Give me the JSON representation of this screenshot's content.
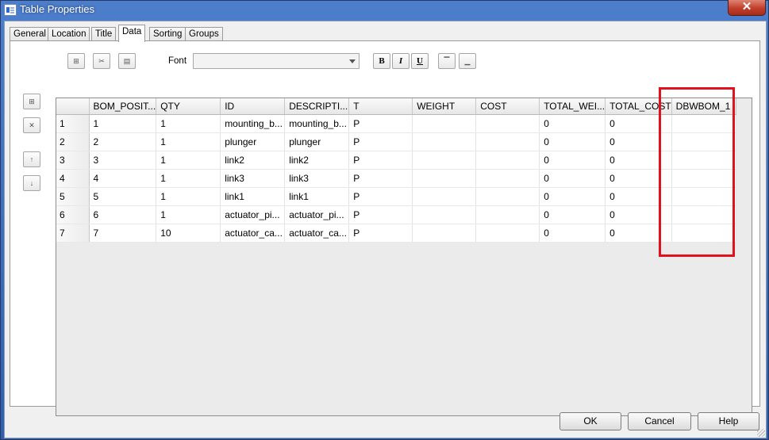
{
  "window": {
    "title": "Table Properties",
    "close_label": "✕"
  },
  "tabs": [
    {
      "label": "General"
    },
    {
      "label": "Location"
    },
    {
      "label": "Title"
    },
    {
      "label": "Data"
    },
    {
      "label": "Sorting"
    },
    {
      "label": "Groups"
    }
  ],
  "active_tab": "Data",
  "toolbar": {
    "font_label": "Font",
    "font_value": "",
    "bold_label": "B",
    "italic_label": "I",
    "underline_label": "U"
  },
  "table": {
    "columns": [
      "BOM_POSIT...",
      "QTY",
      "ID",
      "DESCRIPTI...",
      "T",
      "WEIGHT",
      "COST",
      "TOTAL_WEI...",
      "TOTAL_COST",
      "DBWBOM_1"
    ],
    "rows": [
      {
        "num": "1",
        "cells": [
          "1",
          "1",
          "mounting_b...",
          "mounting_b...",
          "P",
          "",
          "",
          "0",
          "0",
          ""
        ]
      },
      {
        "num": "2",
        "cells": [
          "2",
          "1",
          "plunger",
          "plunger",
          "P",
          "",
          "",
          "0",
          "0",
          ""
        ]
      },
      {
        "num": "3",
        "cells": [
          "3",
          "1",
          "link2",
          "link2",
          "P",
          "",
          "",
          "0",
          "0",
          ""
        ]
      },
      {
        "num": "4",
        "cells": [
          "4",
          "1",
          "link3",
          "link3",
          "P",
          "",
          "",
          "0",
          "0",
          ""
        ]
      },
      {
        "num": "5",
        "cells": [
          "5",
          "1",
          "link1",
          "link1",
          "P",
          "",
          "",
          "0",
          "0",
          ""
        ]
      },
      {
        "num": "6",
        "cells": [
          "6",
          "1",
          "actuator_pi...",
          "actuator_pi...",
          "P",
          "",
          "",
          "0",
          "0",
          ""
        ]
      },
      {
        "num": "7",
        "cells": [
          "7",
          "10",
          "actuator_ca...",
          "actuator_ca...",
          "P",
          "",
          "",
          "0",
          "0",
          ""
        ]
      }
    ]
  },
  "highlight_color": "#e0121c",
  "buttons": {
    "ok": "OK",
    "cancel": "Cancel",
    "help": "Help"
  }
}
